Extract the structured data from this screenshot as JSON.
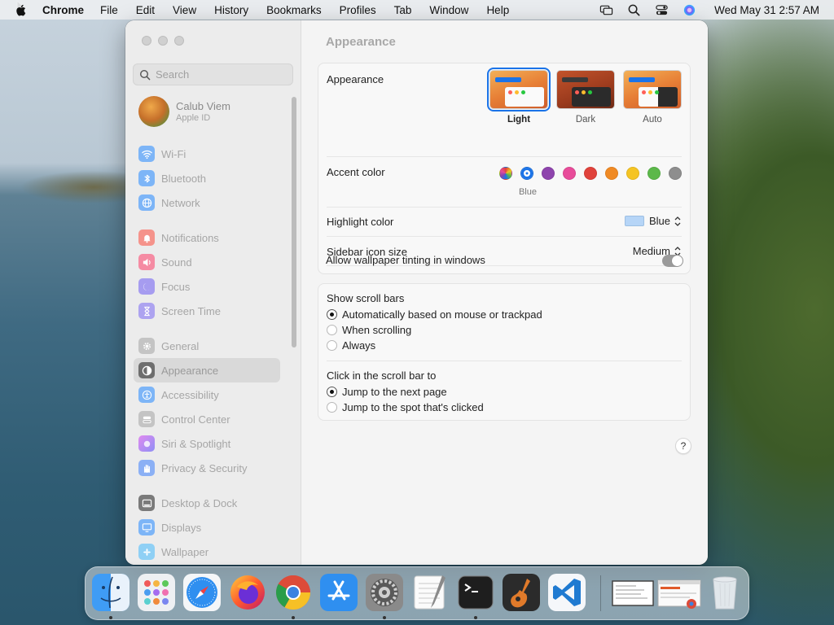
{
  "menubar": {
    "app_name": "Chrome",
    "items": [
      "File",
      "Edit",
      "View",
      "History",
      "Bookmarks",
      "Profiles",
      "Tab",
      "Window",
      "Help"
    ],
    "clock": "Wed May 31  2:57 AM"
  },
  "sidebar": {
    "search_placeholder": "Search",
    "account": {
      "name": "Calub Viem",
      "subtitle": "Apple ID"
    },
    "items": [
      {
        "label": "Wi-Fi",
        "icon": "wifi-icon",
        "color": "#2f8cf7"
      },
      {
        "label": "Bluetooth",
        "icon": "bluetooth-icon",
        "color": "#2f8cf7"
      },
      {
        "label": "Network",
        "icon": "globe-icon",
        "color": "#2f8cf7"
      },
      {
        "label": "Notifications",
        "icon": "bell-icon",
        "color": "#f25a4f"
      },
      {
        "label": "Sound",
        "icon": "speaker-icon",
        "color": "#f25a7a"
      },
      {
        "label": "Focus",
        "icon": "moon-icon",
        "color": "#6b5ce0"
      },
      {
        "label": "Screen Time",
        "icon": "hourglass-icon",
        "color": "#7a6be6"
      },
      {
        "label": "General",
        "icon": "gear-icon",
        "color": "#9a9a9a"
      },
      {
        "label": "Appearance",
        "icon": "appearance-icon",
        "color": "#2b2b2b"
      },
      {
        "label": "Accessibility",
        "icon": "accessibility-icon",
        "color": "#2f8cf7"
      },
      {
        "label": "Control Center",
        "icon": "control-center-icon",
        "color": "#9a9a9a"
      },
      {
        "label": "Siri & Spotlight",
        "icon": "siri-icon",
        "color": "#c55bd8"
      },
      {
        "label": "Privacy & Security",
        "icon": "hand-icon",
        "color": "#3b7df0"
      },
      {
        "label": "Desktop & Dock",
        "icon": "dock-icon",
        "color": "#3a3a3a"
      },
      {
        "label": "Displays",
        "icon": "display-icon",
        "color": "#2f8cf7"
      },
      {
        "label": "Wallpaper",
        "icon": "wallpaper-icon",
        "color": "#3ab0f0"
      }
    ],
    "selected": "Appearance"
  },
  "content": {
    "title": "Appearance",
    "appearance": {
      "label": "Appearance",
      "options": [
        "Light",
        "Dark",
        "Auto"
      ],
      "selected": "Light"
    },
    "accent": {
      "label": "Accent color",
      "colors": [
        "multicolor",
        "#1a73e8",
        "#8e44ad",
        "#e84c9a",
        "#e0423b",
        "#f08a24",
        "#f5c423",
        "#5cb84a",
        "#8e8e8e"
      ],
      "selected_name": "Blue"
    },
    "highlight": {
      "label": "Highlight color",
      "value": "Blue",
      "chip_color": "#b6d5f7"
    },
    "icon_size": {
      "label": "Sidebar icon size",
      "value": "Medium"
    },
    "tinting": {
      "label": "Allow wallpaper tinting in windows",
      "enabled": false
    },
    "scroll_bars": {
      "label": "Show scroll bars",
      "options": [
        "Automatically based on mouse or trackpad",
        "When scrolling",
        "Always"
      ],
      "selected": 0
    },
    "click_scroll": {
      "label": "Click in the scroll bar to",
      "options": [
        "Jump to the next page",
        "Jump to the spot that's clicked"
      ],
      "selected": 0
    },
    "help": "?"
  },
  "dock": {
    "apps": [
      "finder-icon",
      "launchpad-icon",
      "safari-icon",
      "firefox-icon",
      "chrome-icon",
      "app-store-icon",
      "system-settings-icon",
      "textedit-icon",
      "terminal-icon",
      "garageband-icon",
      "vscode-icon",
      "window-thumbnail-1",
      "window-thumbnail-2",
      "trash-icon"
    ]
  }
}
